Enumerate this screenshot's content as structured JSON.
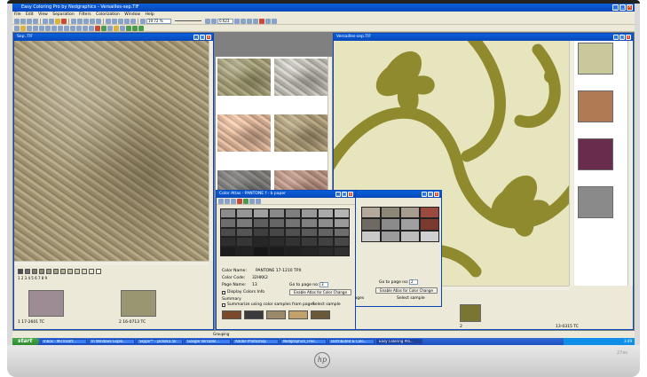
{
  "app": {
    "title": "Easy Coloring Pro by Nedgraphics - Versailles-sep.TIF",
    "menu": [
      "File",
      "Edit",
      "View",
      "Separation",
      "Filters",
      "Colorization",
      "Window",
      "Help"
    ],
    "zoom_value": "19.72 %",
    "ratio_value": "0.623",
    "window_buttons": {
      "minimize": "_",
      "maximize": "□",
      "close": "×"
    }
  },
  "windows": {
    "sep": {
      "title": "Sep..TIF",
      "swatch_numbers": "1 2 3 4 5 6 7 8 9"
    },
    "versailles": {
      "title": "Versailles-sep.TIF"
    }
  },
  "thumbnails": [
    {
      "label": "1 17-2601 TC",
      "color": "#9d8c93"
    },
    {
      "label": "2 16-0713 TC",
      "color": "#9a9672"
    },
    {
      "label": "2",
      "color": "#7b7532"
    },
    {
      "label": "13-0315 TC",
      "color": "#b8c49a"
    }
  ],
  "color_atlas": {
    "title": "Color Atlas - PANTONE f - b paper",
    "color_name_label": "Color Name:",
    "color_name_value": "PANTONE 17-1210 TPX",
    "color_code_label": "Color Code:",
    "color_code_value": "32HKK2",
    "page_name_label": "Page Name:",
    "page_name_value": "13",
    "go_to_page_label": "Go to page no:",
    "go_to_page_value": "3",
    "display_colors_label": "Display Colors Info",
    "enable_atlas_label": "Enable Atlas for Color Change",
    "summary_label": "Summary",
    "summarize_label": "Summarize using color samples from pages",
    "select_sample_label": "Select sample",
    "second_summarize_label": "les from pages",
    "second_go_to_page_value": "2"
  },
  "status": {
    "grouping": "Grouping"
  },
  "taskbar": {
    "start": "start",
    "tasks": [
      "Inbox - Microsoft...",
      "In Windows Explo...",
      "Skype™ - jackek3.5k",
      "Google Versailel...",
      "Adobe Photoshop",
      "Nedgraphics_Free...",
      "Distributed & Colo...",
      "Easy Coloring Pro..."
    ],
    "clock": "3:49"
  },
  "bezel": {
    "logo": "hp",
    "model": "27es"
  },
  "colors": {
    "xp_blue": "#0847b8",
    "window_face": "#ece9d8",
    "start_green": "#3c9a3c"
  }
}
